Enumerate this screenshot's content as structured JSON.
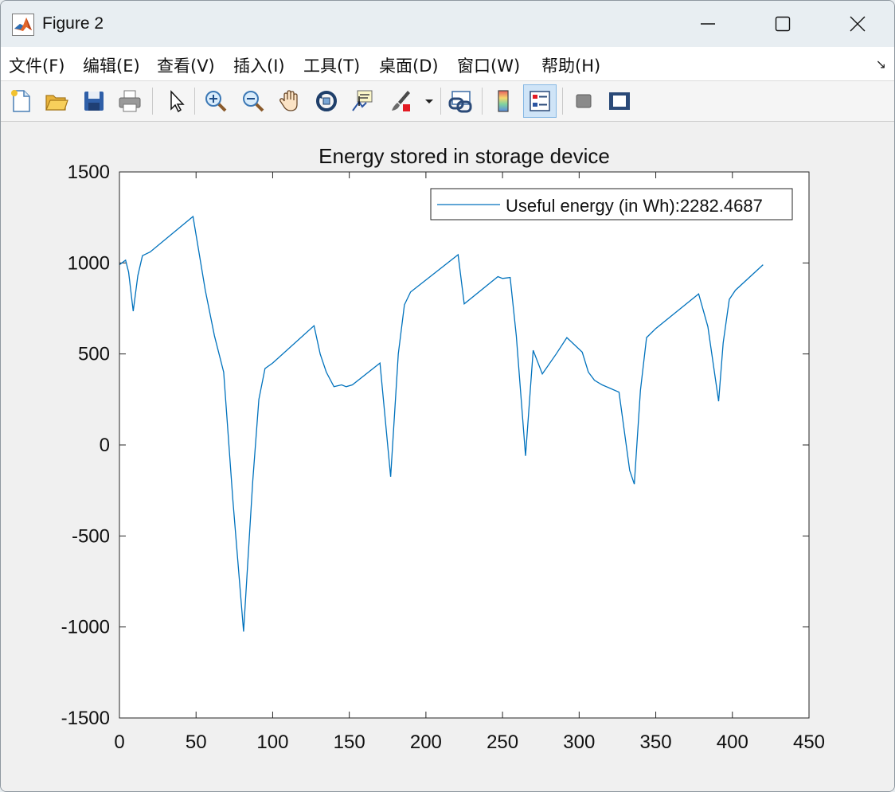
{
  "window": {
    "title": "Figure 2",
    "buttons": [
      "minimize-icon",
      "maximize-icon",
      "close-icon"
    ]
  },
  "menu": {
    "items": [
      "文件(F)",
      "编辑(E)",
      "查看(V)",
      "插入(I)",
      "工具(T)",
      "桌面(D)",
      "窗口(W)",
      "帮助(H)"
    ],
    "overflow_icon": "dock-arrow-icon"
  },
  "toolbar": {
    "icons": [
      "new-figure-icon",
      "open-folder-icon",
      "save-icon",
      "print-icon",
      "pointer-icon",
      "zoom-in-icon",
      "zoom-out-icon",
      "pan-hand-icon",
      "rotate-3d-icon",
      "data-cursor-icon",
      "brush-icon",
      "brush-dropdown-icon",
      "link-plot-icon",
      "colorbar-icon",
      "legend-icon",
      "hide-plot-tools-icon",
      "show-plot-tools-icon"
    ],
    "active": "legend-icon"
  },
  "chart_data": {
    "type": "line",
    "title": "Energy stored in storage device",
    "xlabel": "",
    "ylabel": "",
    "xlim": [
      0,
      450
    ],
    "ylim": [
      -1500,
      1500
    ],
    "xticks": [
      "0",
      "50",
      "100",
      "150",
      "200",
      "250",
      "300",
      "350",
      "400",
      "450"
    ],
    "yticks": [
      "-1500",
      "-1000",
      "-500",
      "0",
      "500",
      "1000",
      "1500"
    ],
    "grid": false,
    "legend": {
      "placement": "top-right",
      "entries": [
        "Useful energy (in Wh):2282.4687"
      ]
    },
    "series": [
      {
        "name": "Useful energy (in Wh):2282.4687",
        "color": "#0072bd",
        "x": [
          0,
          4,
          6,
          9,
          12,
          15,
          20,
          48,
          56,
          62,
          68,
          74,
          81,
          87,
          91,
          95,
          100,
          127,
          131,
          135,
          140,
          145,
          148,
          152,
          170,
          177,
          182,
          186,
          190,
          221,
          225,
          247,
          250,
          255,
          259,
          265,
          270,
          276,
          285,
          292,
          302,
          306,
          310,
          315,
          326,
          333,
          336,
          340,
          344,
          350,
          378,
          384,
          391,
          394,
          398,
          402,
          420
        ],
        "y": [
          990,
          1015,
          950,
          735,
          930,
          1040,
          1060,
          1255,
          850,
          600,
          400,
          -300,
          -1025,
          -200,
          250,
          420,
          450,
          655,
          500,
          400,
          320,
          330,
          320,
          330,
          450,
          -175,
          500,
          770,
          840,
          1045,
          775,
          925,
          915,
          920,
          600,
          -60,
          520,
          390,
          500,
          590,
          510,
          400,
          355,
          330,
          290,
          -140,
          -215,
          300,
          590,
          640,
          830,
          650,
          240,
          560,
          800,
          850,
          990
        ]
      }
    ]
  }
}
